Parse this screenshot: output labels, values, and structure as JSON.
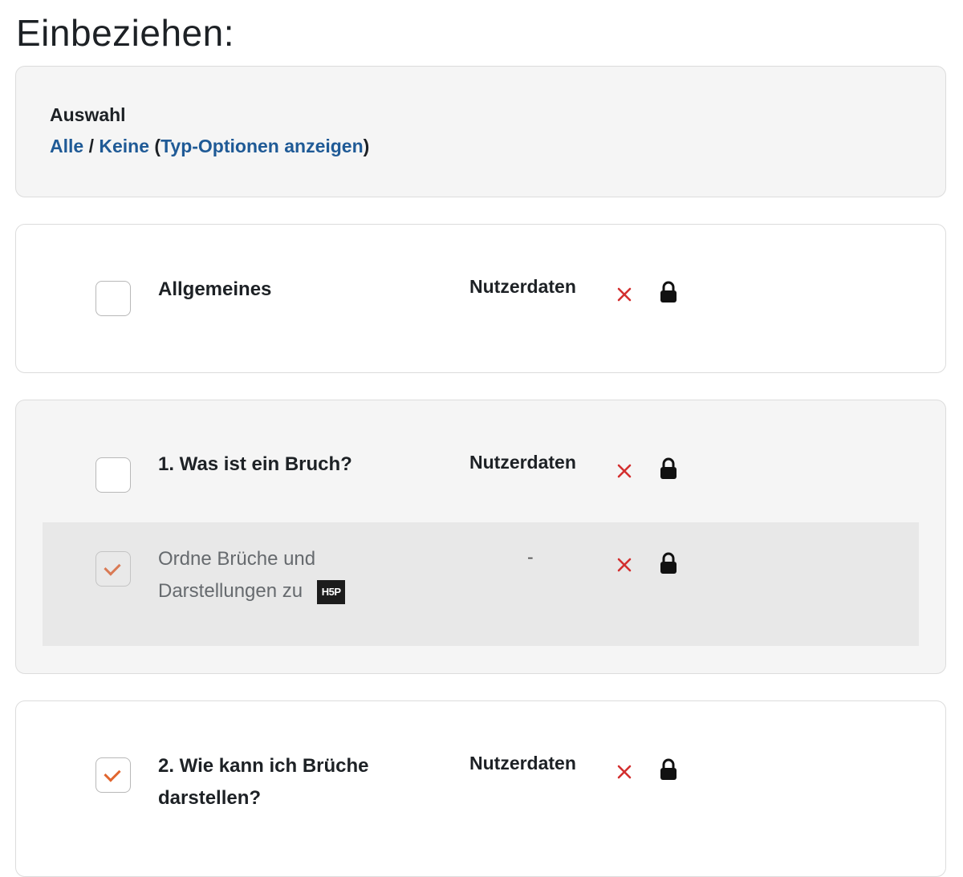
{
  "page": {
    "title": "Einbeziehen:"
  },
  "selection": {
    "heading": "Auswahl",
    "all_label": "Alle",
    "separator": " / ",
    "none_label": "Keine",
    "type_options_open": " (",
    "type_options_label": "Typ-Optionen anzeigen",
    "type_options_close": ")"
  },
  "sections": [
    {
      "title": "Allgemeines",
      "user_data_label": "Nutzerdaten",
      "checked": false
    },
    {
      "title": "1. Was ist ein Bruch?",
      "user_data_label": "Nutzerdaten",
      "checked": false,
      "activities": [
        {
          "title_line1": "Ordne Brüche und",
          "title_line2": "Darstellungen zu",
          "badge": "H5P",
          "user_data_label": "-",
          "checked": true
        }
      ]
    },
    {
      "title_line1": "2. Wie kann ich Brüche",
      "title_line2": "darstellen?",
      "user_data_label": "Nutzerdaten",
      "checked": true
    }
  ],
  "icons": {
    "exclude": "x-icon",
    "lock": "lock-icon",
    "badge": "h5p-icon"
  },
  "colors": {
    "link": "#1f5a96",
    "exclude": "#d32f2f",
    "check": "#e1662f",
    "card_gray": "#f5f5f5"
  }
}
